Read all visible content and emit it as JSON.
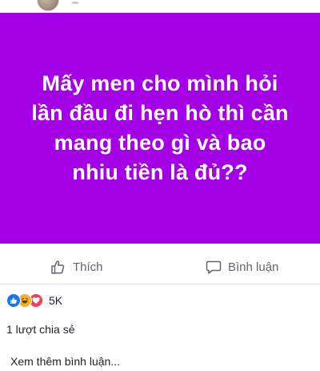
{
  "post": {
    "background_color": "#a400e6",
    "text_color": "#ffffff",
    "text": "Mấy men cho mình hỏi lần đầu đi hẹn hò thì cần mang theo gì và bao nhiu tiền là đủ??"
  },
  "actions": {
    "like_label": "Thích",
    "like_icon": "thumbs-up-icon",
    "comment_label": "Bình luận",
    "comment_icon": "speech-bubble-icon"
  },
  "reactions": {
    "icons": [
      "like-reaction-icon",
      "haha-reaction-icon",
      "love-reaction-icon"
    ],
    "count": "5K"
  },
  "shares_text": "1 lượt chia sẻ",
  "more_comments_text": "Xem thêm bình luận..."
}
